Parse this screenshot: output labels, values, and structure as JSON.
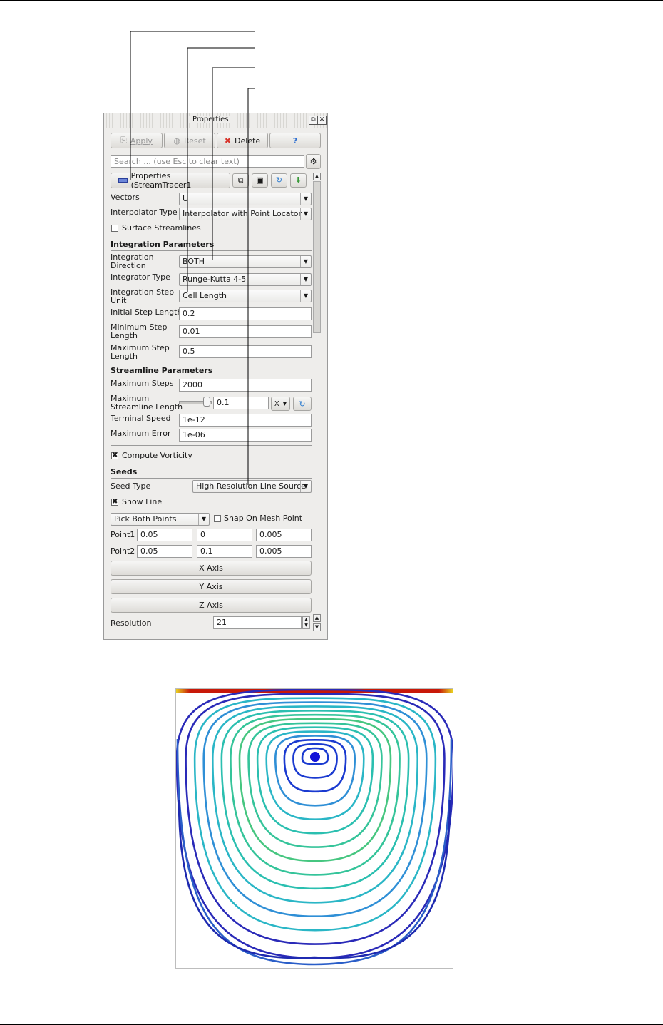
{
  "panel": {
    "title": "Properties",
    "buttons": {
      "apply": "Apply",
      "reset": "Reset",
      "delete": "Delete",
      "help": "?"
    },
    "search_placeholder": "Search ... (use Esc to clear text)",
    "properties_header": "Properties (StreamTracer1",
    "vectors": {
      "label": "Vectors",
      "value": "U"
    },
    "interpolator": {
      "label": "Interpolator Type",
      "value": "Interpolator with Point Locator"
    },
    "surface_streamlines": {
      "label": "Surface Streamlines",
      "checked": false
    },
    "integration_section": "Integration Parameters",
    "integration_direction": {
      "label_line1": "Integration",
      "label_line2": "Direction",
      "value": "BOTH"
    },
    "integrator_type": {
      "label": "Integrator Type",
      "value": "Runge-Kutta 4-5"
    },
    "step_unit": {
      "label_line1": "Integration Step",
      "label_line2": "Unit",
      "value": "Cell Length"
    },
    "initial_step": {
      "label": "Initial Step Length",
      "value": "0.2"
    },
    "min_step": {
      "label_line1": "Minimum Step",
      "label_line2": "Length",
      "value": "0.01"
    },
    "max_step": {
      "label_line1": "Maximum Step",
      "label_line2": "Length",
      "value": "0.5"
    },
    "streamline_section": "Streamline Parameters",
    "max_steps": {
      "label": "Maximum Steps",
      "value": "2000"
    },
    "max_length": {
      "label_line1": "Maximum",
      "label_line2": "Streamline Length",
      "value": "0.1",
      "axis": "X"
    },
    "terminal_speed": {
      "label": "Terminal Speed",
      "value": "1e-12"
    },
    "max_error": {
      "label": "Maximum Error",
      "value": "1e-06"
    },
    "compute_vorticity": {
      "label": "Compute Vorticity",
      "checked": true
    },
    "seeds_section": "Seeds",
    "seed_type": {
      "label": "Seed Type",
      "value": "High Resolution Line Source"
    },
    "show_line": {
      "label": "Show Line",
      "checked": true
    },
    "pick_points": "Pick Both Points",
    "snap": {
      "label": "Snap On Mesh Point",
      "checked": false
    },
    "point1": {
      "label": "Point1",
      "x": "0.05",
      "y": "0",
      "z": "0.005"
    },
    "point2": {
      "label": "Point2",
      "x": "0.05",
      "y": "0.1",
      "z": "0.005"
    },
    "axis_buttons": {
      "x": "X Axis",
      "y": "Y Axis",
      "z": "Z Axis"
    },
    "resolution": {
      "label": "Resolution",
      "value": "21"
    }
  },
  "colors": {
    "lid": "#d11a10",
    "vortex_core": "#1414d8",
    "outer": "#1a1aa0"
  }
}
